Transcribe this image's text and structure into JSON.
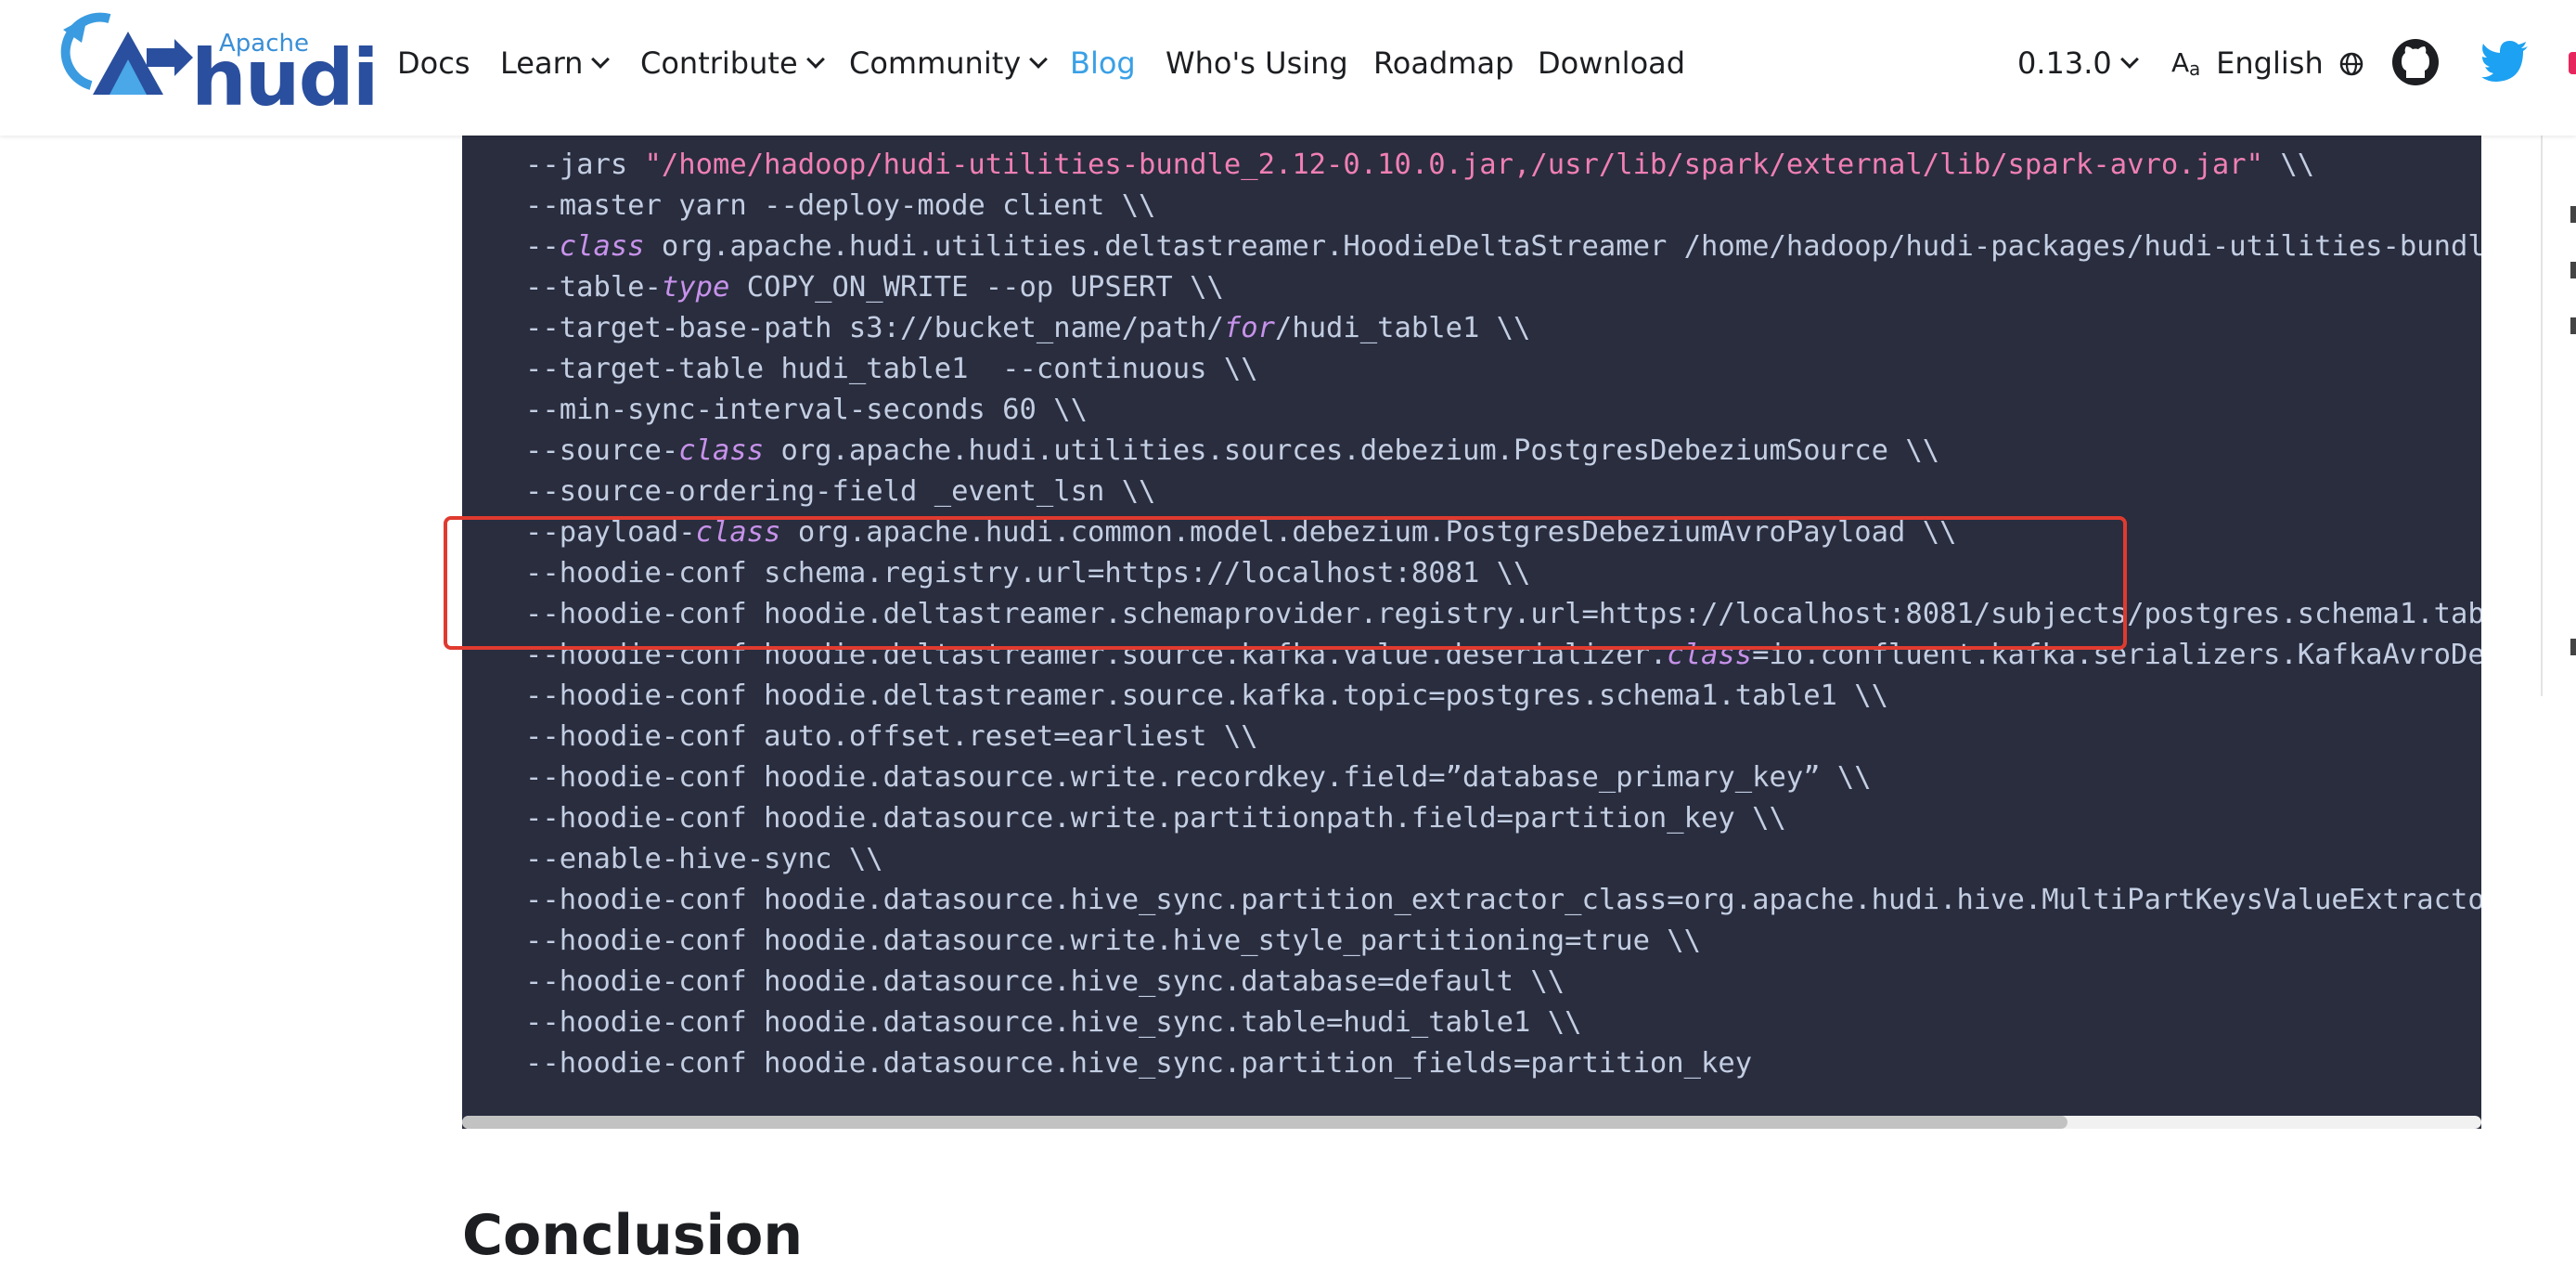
{
  "brand": {
    "apache": "Apache",
    "name": "hudi"
  },
  "nav": {
    "docs": "Docs",
    "learn": "Learn",
    "contribute": "Contribute",
    "community": "Community",
    "blog": "Blog",
    "whos_using": "Who's Using",
    "roadmap": "Roadmap",
    "download": "Download",
    "version": "0.13.0",
    "language": "English"
  },
  "code": {
    "lines": [
      [
        {
          "t": "--jars "
        },
        {
          "t": "\"/home/hadoop/hudi-utilities-bundle_2.12-0.10.0.jar,/usr/lib/spark/external/lib/spark-avro.jar\"",
          "c": "str"
        },
        {
          "t": " \\\\"
        }
      ],
      [
        {
          "t": "--master yarn --deploy-mode client \\\\"
        }
      ],
      [
        {
          "t": "--"
        },
        {
          "t": "class",
          "c": "kw"
        },
        {
          "t": " org.apache.hudi.utilities.deltastreamer.HoodieDeltaStreamer /home/hadoop/hudi-packages/hudi-utilities-bundl"
        }
      ],
      [
        {
          "t": "--table-"
        },
        {
          "t": "type",
          "c": "kw"
        },
        {
          "t": " COPY_ON_WRITE --op UPSERT \\\\"
        }
      ],
      [
        {
          "t": "--target-base-path s3://bucket_name/path/"
        },
        {
          "t": "for",
          "c": "kw"
        },
        {
          "t": "/hudi_table1 \\\\"
        }
      ],
      [
        {
          "t": "--target-table hudi_table1  --continuous \\\\"
        }
      ],
      [
        {
          "t": "--min-sync-interval-seconds 60 \\\\"
        }
      ],
      [
        {
          "t": "--source-"
        },
        {
          "t": "class",
          "c": "kw"
        },
        {
          "t": " org.apache.hudi.utilities.sources.debezium.PostgresDebeziumSource \\\\"
        }
      ],
      [
        {
          "t": "--source-ordering-field _event_lsn \\\\"
        }
      ],
      [
        {
          "t": "--payload-"
        },
        {
          "t": "class",
          "c": "kw"
        },
        {
          "t": " org.apache.hudi.common.model.debezium.PostgresDebeziumAvroPayload \\\\"
        }
      ],
      [
        {
          "t": "--hoodie-conf schema.registry.url=https://localhost:8081 \\\\"
        }
      ],
      [
        {
          "t": "--hoodie-conf hoodie.deltastreamer.schemaprovider.registry.url=https://localhost:8081/subjects/postgres.schema1.tab"
        }
      ],
      [
        {
          "t": "--hoodie-conf hoodie.deltastreamer.source.kafka.value.deserializer."
        },
        {
          "t": "class",
          "c": "kw"
        },
        {
          "t": "=io.confluent.kafka.serializers.KafkaAvroDe"
        }
      ],
      [
        {
          "t": "--hoodie-conf hoodie.deltastreamer.source.kafka.topic=postgres.schema1.table1 \\\\"
        }
      ],
      [
        {
          "t": "--hoodie-conf auto.offset.reset=earliest \\\\"
        }
      ],
      [
        {
          "t": "--hoodie-conf hoodie.datasource.write.recordkey.field=”database_primary_key” \\\\"
        }
      ],
      [
        {
          "t": "--hoodie-conf hoodie.datasource.write.partitionpath.field=partition_key \\\\"
        }
      ],
      [
        {
          "t": "--enable-hive-sync \\\\"
        }
      ],
      [
        {
          "t": "--hoodie-conf hoodie.datasource.hive_sync.partition_extractor_class=org.apache.hudi.hive.MultiPartKeysValueExtracto"
        }
      ],
      [
        {
          "t": "--hoodie-conf hoodie.datasource.write.hive_style_partitioning=true \\\\"
        }
      ],
      [
        {
          "t": "--hoodie-conf hoodie.datasource.hive_sync.database=default \\\\"
        }
      ],
      [
        {
          "t": "--hoodie-conf hoodie.datasource.hive_sync.table=hudi_table1 \\\\"
        }
      ],
      [
        {
          "t": "--hoodie-conf hoodie.datasource.hive_sync.partition_fields=partition_key"
        }
      ]
    ]
  },
  "heading": "Conclusion",
  "icons": {
    "chevron": "chevron-down-icon",
    "language": "translate-icon",
    "globe": "globe-icon",
    "github": "github-icon",
    "twitter": "twitter-icon"
  },
  "colors": {
    "accent": "#3aa0e6",
    "code_bg": "#292d3e",
    "highlight_box": "#e03a2f",
    "string": "#f07fb4",
    "keyword": "#c792ea"
  }
}
